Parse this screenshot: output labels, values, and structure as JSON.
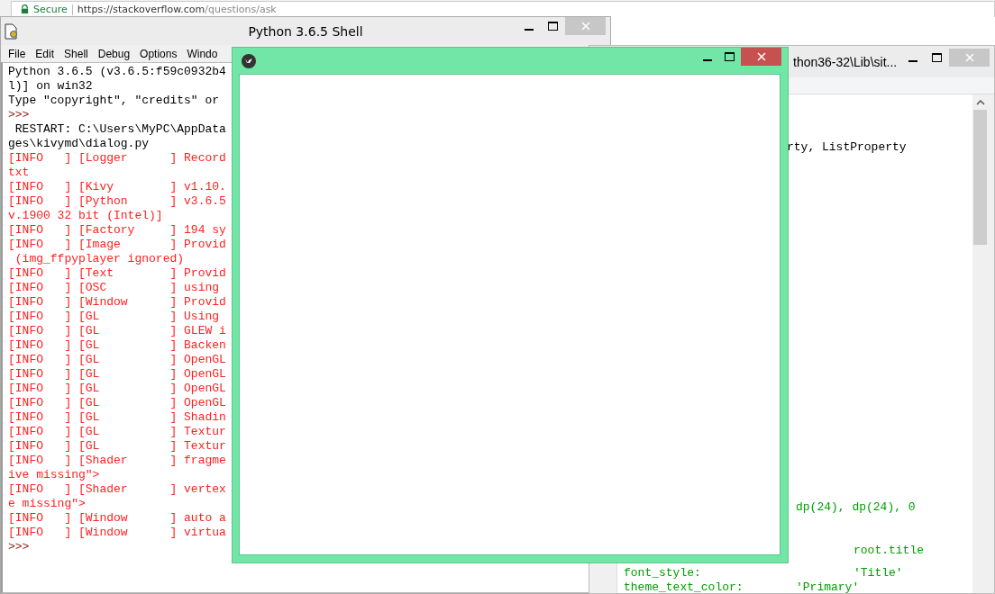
{
  "browser": {
    "security_label": "Secure",
    "url_host": "https://stackoverflow.com",
    "url_path": "/questions/ask"
  },
  "shell_window": {
    "title": "Python 3.6.5 Shell",
    "menu": [
      "File",
      "Edit",
      "Shell",
      "Debug",
      "Options",
      "Windo"
    ],
    "lines": [
      {
        "text": "Python 3.6.5 (v3.6.5:f59c0932b4",
        "kind": "output"
      },
      {
        "text": "l)] on win32",
        "kind": "output"
      },
      {
        "text": "Type \"copyright\", \"credits\" or",
        "kind": "output"
      },
      {
        "text": ">>>",
        "kind": "prompt"
      },
      {
        "text": " RESTART: C:\\Users\\MyPC\\AppData",
        "kind": "output"
      },
      {
        "text": "ges\\kivymd\\dialog.py",
        "kind": "output"
      },
      {
        "text": "[INFO   ] [Logger      ] Record",
        "kind": "error"
      },
      {
        "text": "txt",
        "kind": "error"
      },
      {
        "text": "[INFO   ] [Kivy        ] v1.10.",
        "kind": "error"
      },
      {
        "text": "[INFO   ] [Python      ] v3.6.5",
        "kind": "error"
      },
      {
        "text": "v.1900 32 bit (Intel)]",
        "kind": "error"
      },
      {
        "text": "[INFO   ] [Factory     ] 194 sy",
        "kind": "error"
      },
      {
        "text": "[INFO   ] [Image       ] Provid",
        "kind": "error"
      },
      {
        "text": " (img_ffpyplayer ignored)",
        "kind": "error"
      },
      {
        "text": "[INFO   ] [Text        ] Provid",
        "kind": "error"
      },
      {
        "text": "[INFO   ] [OSC         ] using",
        "kind": "error"
      },
      {
        "text": "[INFO   ] [Window      ] Provid",
        "kind": "error"
      },
      {
        "text": "[INFO   ] [GL          ] Using",
        "kind": "error"
      },
      {
        "text": "[INFO   ] [GL          ] GLEW i",
        "kind": "error"
      },
      {
        "text": "[INFO   ] [GL          ] Backen",
        "kind": "error"
      },
      {
        "text": "[INFO   ] [GL          ] OpenGL",
        "kind": "error"
      },
      {
        "text": "[INFO   ] [GL          ] OpenGL",
        "kind": "error"
      },
      {
        "text": "[INFO   ] [GL          ] OpenGL",
        "kind": "error"
      },
      {
        "text": "[INFO   ] [GL          ] OpenGL",
        "kind": "error"
      },
      {
        "text": "[INFO   ] [GL          ] Shadin",
        "kind": "error"
      },
      {
        "text": "[INFO   ] [GL          ] Textur",
        "kind": "error"
      },
      {
        "text": "[INFO   ] [GL          ] Textur",
        "kind": "error"
      },
      {
        "text": "[INFO   ] [Shader      ] fragme",
        "kind": "error"
      },
      {
        "text": "ive missing\">",
        "kind": "error"
      },
      {
        "text": "[INFO   ] [Shader      ] vertex",
        "kind": "error"
      },
      {
        "text": "e missing\">",
        "kind": "error"
      },
      {
        "text": "[INFO   ] [Window      ] auto a",
        "kind": "error"
      },
      {
        "text": "[INFO   ] [Window      ] virtua",
        "kind": "error"
      },
      {
        "text": ">>>",
        "kind": "prompt"
      }
    ]
  },
  "editor_window": {
    "title": "thon36-32\\Lib\\sit...",
    "lines": [
      {
        "text": "rty, ListProperty",
        "kind": "code"
      },
      {
        "text": "dp(24), dp(24), 0",
        "kind": "string"
      },
      {
        "text": "root.title",
        "kind": "string"
      },
      {
        "text": "font_style:",
        "kind": "string"
      },
      {
        "text": "'Title'",
        "kind": "string"
      },
      {
        "text": "theme_text_color:",
        "kind": "string"
      },
      {
        "text": "'Primary'",
        "kind": "string"
      }
    ]
  }
}
